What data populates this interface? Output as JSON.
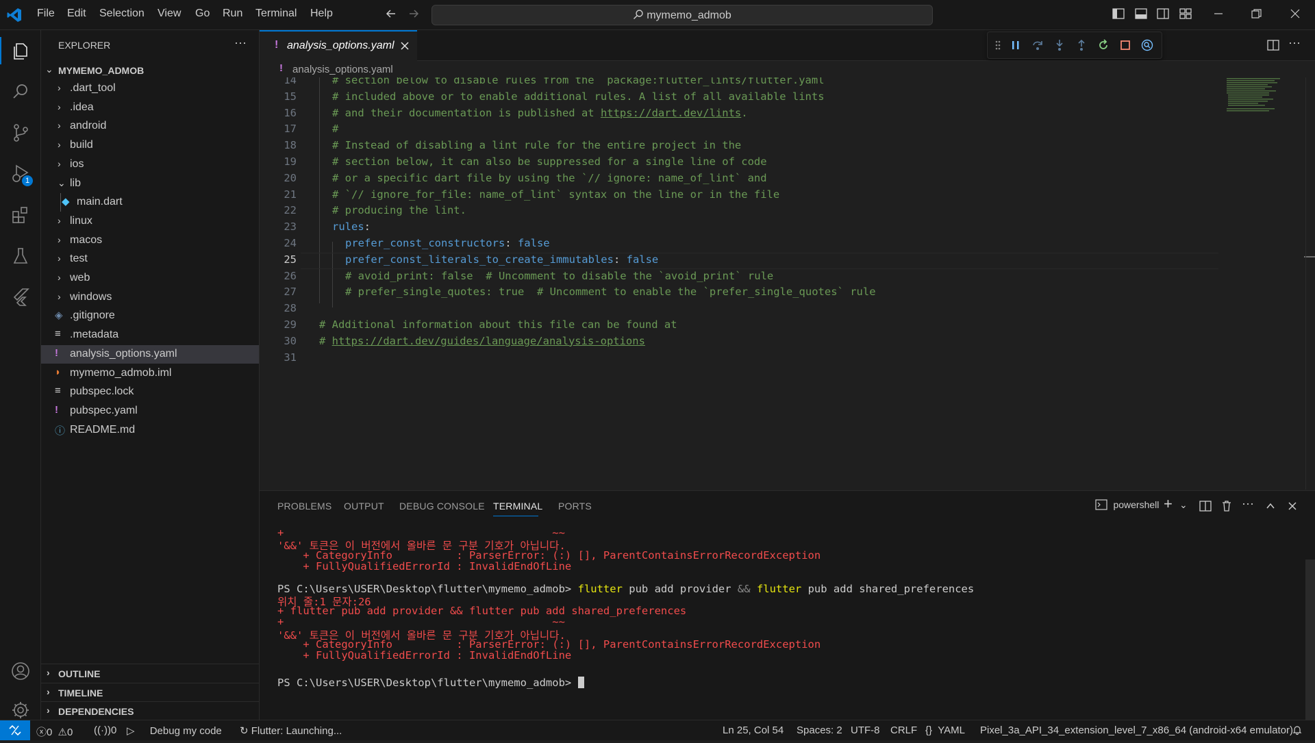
{
  "menu": [
    "File",
    "Edit",
    "Selection",
    "View",
    "Go",
    "Run",
    "Terminal",
    "Help"
  ],
  "search": {
    "text": "mymemo_admob"
  },
  "explorer": {
    "title": "EXPLORER",
    "root": "MYMEMO_ADMOB",
    "items": [
      {
        "label": ".dart_tool",
        "kind": "folder"
      },
      {
        "label": ".idea",
        "kind": "folder"
      },
      {
        "label": "android",
        "kind": "folder"
      },
      {
        "label": "build",
        "kind": "folder"
      },
      {
        "label": "ios",
        "kind": "folder"
      },
      {
        "label": "lib",
        "kind": "folder-open"
      },
      {
        "label": "main.dart",
        "kind": "dart"
      },
      {
        "label": "linux",
        "kind": "folder"
      },
      {
        "label": "macos",
        "kind": "folder"
      },
      {
        "label": "test",
        "kind": "folder"
      },
      {
        "label": "web",
        "kind": "folder"
      },
      {
        "label": "windows",
        "kind": "folder"
      },
      {
        "label": ".gitignore",
        "kind": "git"
      },
      {
        "label": ".metadata",
        "kind": "lines"
      },
      {
        "label": "analysis_options.yaml",
        "kind": "yaml"
      },
      {
        "label": "mymemo_admob.iml",
        "kind": "rss"
      },
      {
        "label": "pubspec.lock",
        "kind": "lines"
      },
      {
        "label": "pubspec.yaml",
        "kind": "yaml"
      },
      {
        "label": "README.md",
        "kind": "info"
      }
    ],
    "sections": [
      "OUTLINE",
      "TIMELINE",
      "DEPENDENCIES"
    ]
  },
  "editor": {
    "tab": "analysis_options.yaml",
    "tab_mark": "!",
    "breadcrumb": "analysis_options.yaml",
    "current_line": "25",
    "lines": [
      {
        "n": "14",
        "indent": 1,
        "parts": [
          {
            "t": "# section below to disable rules from the `package:flutter_lints/flutter.yaml`",
            "c": "cmt"
          }
        ]
      },
      {
        "n": "15",
        "indent": 1,
        "parts": [
          {
            "t": "# included above or to enable additional rules. A list of all available lints",
            "c": "cmt"
          }
        ]
      },
      {
        "n": "16",
        "indent": 1,
        "parts": [
          {
            "t": "# and their documentation is published at ",
            "c": "cmt"
          },
          {
            "t": "https://dart.dev/lints",
            "c": "cmt link"
          },
          {
            "t": ".",
            "c": "cmt"
          }
        ]
      },
      {
        "n": "17",
        "indent": 1,
        "parts": [
          {
            "t": "#",
            "c": "cmt"
          }
        ]
      },
      {
        "n": "18",
        "indent": 1,
        "parts": [
          {
            "t": "# Instead of disabling a lint rule for the entire project in the",
            "c": "cmt"
          }
        ]
      },
      {
        "n": "19",
        "indent": 1,
        "parts": [
          {
            "t": "# section below, it can also be suppressed for a single line of code",
            "c": "cmt"
          }
        ]
      },
      {
        "n": "20",
        "indent": 1,
        "parts": [
          {
            "t": "# or a specific dart file by using the `// ignore: name_of_lint` and",
            "c": "cmt"
          }
        ]
      },
      {
        "n": "21",
        "indent": 1,
        "parts": [
          {
            "t": "# `// ignore_for_file: name_of_lint` syntax on the line or in the file",
            "c": "cmt"
          }
        ]
      },
      {
        "n": "22",
        "indent": 1,
        "parts": [
          {
            "t": "# producing the lint.",
            "c": "cmt"
          }
        ]
      },
      {
        "n": "23",
        "indent": 1,
        "parts": [
          {
            "t": "rules",
            "c": "key"
          },
          {
            "t": ":",
            "c": "pun"
          }
        ]
      },
      {
        "n": "24",
        "indent": 2,
        "parts": [
          {
            "t": "prefer_const_constructors",
            "c": "key"
          },
          {
            "t": ": ",
            "c": "pun"
          },
          {
            "t": "false",
            "c": "boolv"
          }
        ]
      },
      {
        "n": "25",
        "indent": 2,
        "parts": [
          {
            "t": "prefer_const_literals_to_create_immutables",
            "c": "key"
          },
          {
            "t": ": ",
            "c": "pun"
          },
          {
            "t": "false",
            "c": "boolv"
          }
        ]
      },
      {
        "n": "26",
        "indent": 2,
        "parts": [
          {
            "t": "# avoid_print: false  # Uncomment to disable the `avoid_print` rule",
            "c": "cmt"
          }
        ]
      },
      {
        "n": "27",
        "indent": 2,
        "parts": [
          {
            "t": "# prefer_single_quotes: true  # Uncomment to enable the `prefer_single_quotes` rule",
            "c": "cmt"
          }
        ]
      },
      {
        "n": "28",
        "indent": 0,
        "parts": []
      },
      {
        "n": "29",
        "indent": 0,
        "parts": [
          {
            "t": "# Additional information about this file can be found at",
            "c": "cmt"
          }
        ]
      },
      {
        "n": "30",
        "indent": 0,
        "parts": [
          {
            "t": "# ",
            "c": "cmt"
          },
          {
            "t": "https://dart.dev/guides/language/analysis-options",
            "c": "cmt link"
          }
        ]
      },
      {
        "n": "31",
        "indent": 0,
        "parts": []
      }
    ]
  },
  "panel": {
    "tabs": [
      "PROBLEMS",
      "OUTPUT",
      "DEBUG CONSOLE",
      "TERMINAL",
      "PORTS"
    ],
    "active_tab": "TERMINAL",
    "shell": "powershell",
    "terminal_lines": [
      {
        "parts": [
          {
            "t": "+                                          ~~",
            "c": "red"
          }
        ]
      },
      {
        "parts": [
          {
            "t": "'&&' 토큰은 이 버전에서 올바른 문 구분 기호가 아닙니다.",
            "c": "red"
          }
        ]
      },
      {
        "parts": [
          {
            "t": "    + CategoryInfo          : ParserError: (:) [], ParentContainsErrorRecordException",
            "c": "red"
          }
        ]
      },
      {
        "parts": [
          {
            "t": "    + FullyQualifiedErrorId : InvalidEndOfLine",
            "c": "red"
          }
        ]
      },
      {
        "parts": []
      },
      {
        "parts": [
          {
            "t": "PS C:\\Users\\USER\\Desktop\\flutter\\mymemo_admob> ",
            "c": "white"
          },
          {
            "t": "flutter",
            "c": "yellow"
          },
          {
            "t": " pub add provider ",
            "c": "white"
          },
          {
            "t": "&&",
            "c": "grey"
          },
          {
            "t": " ",
            "c": "white"
          },
          {
            "t": "flutter",
            "c": "yellow"
          },
          {
            "t": " pub add shared_preferences",
            "c": "white"
          }
        ]
      },
      {
        "parts": [
          {
            "t": "위치 줄:1 문자:26",
            "c": "red"
          }
        ]
      },
      {
        "parts": [
          {
            "t": "+ flutter pub add provider && flutter pub add shared_preferences",
            "c": "red"
          }
        ]
      },
      {
        "parts": [
          {
            "t": "+                                          ~~",
            "c": "red"
          }
        ]
      },
      {
        "parts": [
          {
            "t": "'&&' 토큰은 이 버전에서 올바른 문 구분 기호가 아닙니다.",
            "c": "red"
          }
        ]
      },
      {
        "parts": [
          {
            "t": "    + CategoryInfo          : ParserError: (:) [], ParentContainsErrorRecordException",
            "c": "red"
          }
        ]
      },
      {
        "parts": [
          {
            "t": "    + FullyQualifiedErrorId : InvalidEndOfLine",
            "c": "red"
          }
        ]
      },
      {
        "parts": []
      },
      {
        "parts": [
          {
            "t": "PS C:\\Users\\USER\\Desktop\\flutter\\mymemo_admob> ",
            "c": "white"
          }
        ]
      }
    ]
  },
  "status": {
    "errors": "0",
    "warnings": "0",
    "ports": "0",
    "debug": "Debug my code",
    "flutter": "Flutter: Launching...",
    "position": "Ln 25, Col 54",
    "spaces": "Spaces: 2",
    "encoding": "UTF-8",
    "eol": "CRLF",
    "language": "YAML",
    "device": "Pixel_3a_API_34_extension_level_7_x86_64 (android-x64 emulator)"
  },
  "badges": {
    "run_debug": "1"
  },
  "colors": {
    "accent": "#0078d4",
    "error": "#f14c4c",
    "comment": "#6a9955",
    "keyword": "#569cd6"
  }
}
